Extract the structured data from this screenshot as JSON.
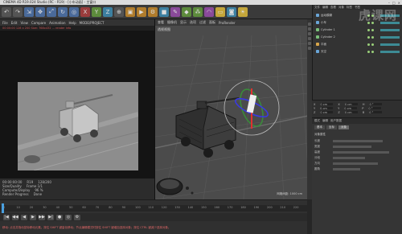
{
  "window": {
    "title": "CINEMA 4D R19.024 Studio (RC - R19) - [小车动画] - 主窗口",
    "controls": [
      "–",
      "□",
      "×"
    ]
  },
  "watermark": "虎课网",
  "toolbar": {
    "icons": [
      "undo-icon",
      "redo-icon",
      "select-icon",
      "move-icon",
      "scale-icon",
      "rotate-icon",
      "live-select-icon",
      "x-axis-icon",
      "y-axis-icon",
      "z-axis-icon",
      "world-icon",
      "render-view-icon",
      "render-icon",
      "render-settings-icon",
      "cube-icon",
      "pen-icon",
      "subdivision-icon",
      "array-icon",
      "deformer-icon",
      "floor-icon",
      "camera-icon",
      "light-icon"
    ]
  },
  "picture_viewer": {
    "menu": [
      "File",
      "Edit",
      "View",
      "Compare",
      "Animation",
      "Help",
      "MODE/PROJECT"
    ],
    "info_line": "00:00:00 128 x 200 Size: 768x432 ... render info",
    "status_rows": [
      [
        "00:00:00:00",
        "R19",
        "128/200"
      ],
      [
        "Size/Quality",
        "Frame 1/1"
      ],
      [
        "Compute/Display",
        "96 %"
      ],
      [
        "Render Progress",
        "Done"
      ]
    ]
  },
  "viewport": {
    "menu": [
      "查看",
      "摄像机",
      "显示",
      "选项",
      "过滤",
      "面板",
      "ProRender"
    ],
    "label": "透视视图",
    "footer": "网格间距: 1000 cm"
  },
  "timeline": {
    "ticks": [
      "0",
      "10",
      "20",
      "30",
      "40",
      "50",
      "60",
      "70",
      "80",
      "90",
      "100",
      "110",
      "120",
      "130",
      "140",
      "150",
      "160",
      "170",
      "180",
      "190",
      "200",
      "210",
      "220"
    ],
    "buttons": [
      "|◀",
      "◀◀",
      "◀",
      "▶",
      "▶▶",
      "▶|",
      "●",
      "◎",
      "⚙"
    ],
    "status": "移动: 点击并拖动鼠标移动元素。按住 SHIFT 键量化移动；节点编辑模式时按住 SHIFT 键增加选择对象；按住 CTRL 键减少选择对象。"
  },
  "object_manager": {
    "menu": [
      "文件",
      "编辑",
      "查看",
      "对象",
      "标签",
      "书签"
    ],
    "rows": [
      {
        "name": "运动模糊",
        "icon_color": "#6aa6d8"
      },
      {
        "name": "小车",
        "icon_color": "#6aa6d8"
      },
      {
        "name": "Cylinder 1",
        "icon_color": "#7ac07a"
      },
      {
        "name": "Cylinder 2",
        "icon_color": "#7ac07a"
      },
      {
        "name": "平面",
        "icon_color": "#d8a64a"
      },
      {
        "name": "天空",
        "icon_color": "#6aa6d8"
      }
    ]
  },
  "coordinates": {
    "rows": [
      [
        "X",
        "0 cm",
        "X",
        "0 cm",
        "H",
        "0 °"
      ],
      [
        "Y",
        "0 cm",
        "Y",
        "0 cm",
        "P",
        "0 °"
      ],
      [
        "Z",
        "0 cm",
        "Z",
        "0 cm",
        "B",
        "0 °"
      ]
    ],
    "apply_label": "应用"
  },
  "attributes": {
    "menu": [
      "模式",
      "编辑",
      "用户数据"
    ],
    "tabs": [
      "基本",
      "坐标",
      "对象"
    ],
    "section": "对象属性",
    "rows": [
      "长度",
      "宽度",
      "高度",
      "分段",
      "方向",
      "圆角"
    ]
  }
}
